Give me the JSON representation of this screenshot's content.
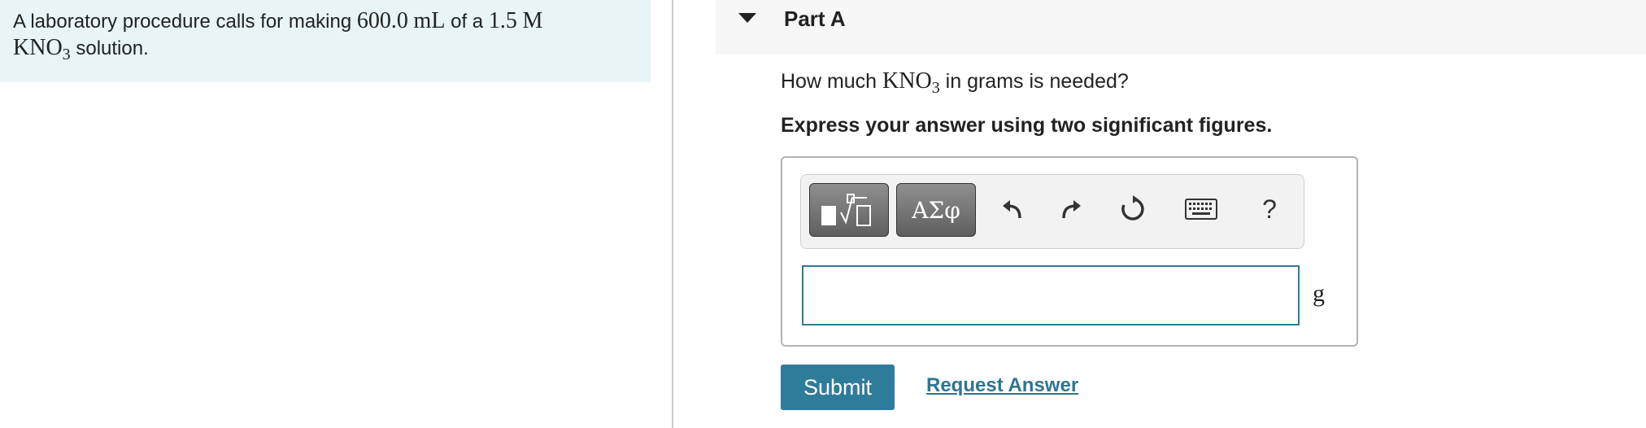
{
  "problem": {
    "text_1": "A laboratory procedure calls for making ",
    "volume": "600.0",
    "volume_unit": "mL",
    "text_2": " of a ",
    "molarity": "1.5",
    "molarity_unit": "M",
    "compound_main": "KNO",
    "compound_sub": "3",
    "text_3": " solution."
  },
  "part": {
    "title": "Part A"
  },
  "question": {
    "prefix": "How much ",
    "compound_main": "KNO",
    "compound_sub": "3",
    "suffix": " in grams is needed?"
  },
  "instruction": "Express your answer using two significant figures.",
  "toolbar": {
    "greek_label": "ΑΣφ",
    "help_label": "?"
  },
  "answer": {
    "value": "",
    "unit": "g"
  },
  "buttons": {
    "submit": "Submit",
    "request_answer": "Request Answer"
  }
}
